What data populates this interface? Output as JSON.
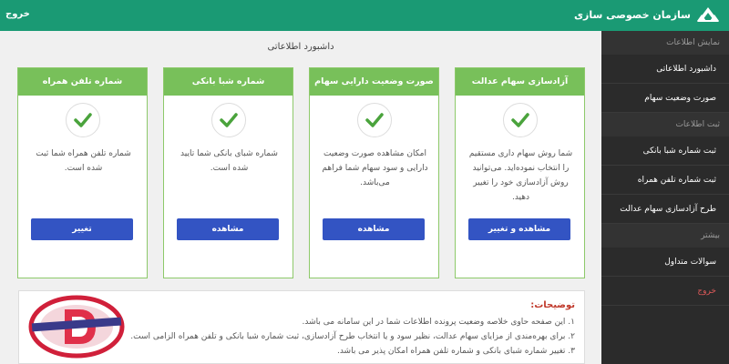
{
  "topbar": {
    "logout_label": "خروج",
    "brand_title": "سازمان خصوصی سازی",
    "bg_color": "#1a9a74"
  },
  "sidebar": {
    "sections": [
      {
        "title": "نمایش اطلاعات",
        "items": [
          "داشبورد اطلاعاتی",
          "صورت وضعیت سهام"
        ]
      },
      {
        "title": "ثبت اطلاعات",
        "items": [
          "ثبت شماره شبا بانکی",
          "ثبت شماره تلفن همراه",
          "طرح آزادسازی سهام عدالت"
        ]
      },
      {
        "title": "بیشتر",
        "items": [
          "سوالات متداول"
        ]
      }
    ],
    "logout_label": "خروج"
  },
  "main": {
    "title": "داشبورد اطلاعاتی",
    "cards": [
      {
        "title": "آزادسازی سهام عدالت",
        "text": "شما روش سهام داری مستقیم را انتخاب نموده‌اید. می‌توانید روش آزادسازی خود را تغییر دهید.",
        "button": "مشاهده و تغییر"
      },
      {
        "title": "صورت وضعیت دارایی سهام",
        "text": "امکان مشاهده صورت وضعیت دارایی و سود سهام شما فراهم می‌باشد.",
        "button": "مشاهده"
      },
      {
        "title": "شماره شبا بانکی",
        "text": "شماره شبای بانکی شما تایید شده است.",
        "button": "مشاهده"
      },
      {
        "title": "شماره تلفن همراه",
        "text": "شماره تلفن همراه شما ثبت شده است.",
        "button": "تغییر"
      }
    ],
    "accent_green": "#78c05a",
    "button_blue": "#3354c3"
  },
  "notes": {
    "title": "توضیحات:",
    "lines": [
      "۱. این صفحه حاوی خلاصه وضعیت پرونده اطلاعات شما در این سامانه می باشد.",
      "۲. برای بهره‌مندی از مزایای سهام عدالت، نظیر سود و یا انتخاب طرح آزادسازی، ثبت شماره شبا بانکی و تلفن همراه الزامی است.",
      "۳. تغییر شماره شبای بانکی و شماره تلفن همراه امکان پذیر می باشد."
    ],
    "watermark_text": "www.Datisnetwork.com"
  }
}
